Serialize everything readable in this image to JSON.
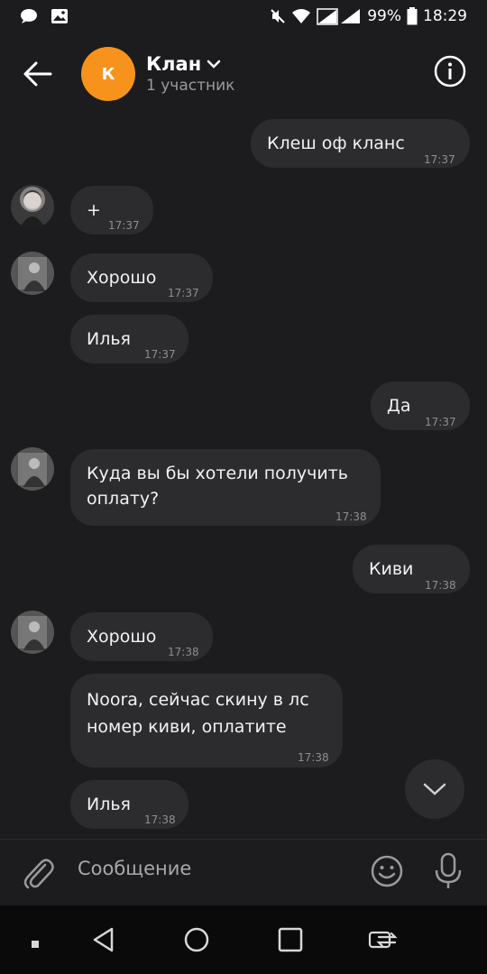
{
  "status_bar": {
    "battery": "99%",
    "time": "18:29"
  },
  "header": {
    "avatar_letter": "К",
    "title": "Клан",
    "subtitle": "1 участник"
  },
  "messages": [
    {
      "text": "Клеш оф кланс",
      "time": "17:37",
      "side": "out"
    },
    {
      "text": "+",
      "time": "17:37",
      "side": "in"
    },
    {
      "text": "Хорошо",
      "time": "17:37",
      "side": "in"
    },
    {
      "text": "Илья",
      "time": "17:37",
      "side": "in"
    },
    {
      "text": "Да",
      "time": "17:37",
      "side": "out"
    },
    {
      "text": "Куда вы бы хотели получить оплату?",
      "time": "17:38",
      "side": "in"
    },
    {
      "text": "Киви",
      "time": "17:38",
      "side": "out"
    },
    {
      "text": "Хорошо",
      "time": "17:38",
      "side": "in"
    },
    {
      "text": "Noora, сейчас скину в лс номер киви, оплатите",
      "time": "17:38",
      "side": "in"
    },
    {
      "text": "Илья",
      "time": "17:38",
      "side": "in"
    }
  ],
  "composer": {
    "placeholder": "Сообщение"
  },
  "icons": [
    "chat-bubble-icon",
    "image-icon",
    "mute-icon",
    "wifi-icon",
    "signal-icon",
    "battery-icon",
    "back-arrow-icon",
    "info-icon",
    "chevron-down-icon",
    "paperclip-icon",
    "emoji-icon",
    "microphone-icon",
    "nav-dot-icon",
    "nav-back-icon",
    "nav-home-icon",
    "nav-recents-icon",
    "nav-switch-icon"
  ],
  "colors": {
    "background": "#1c1c1e",
    "bubble": "#2c2c2e",
    "avatar": "#f7931d"
  }
}
